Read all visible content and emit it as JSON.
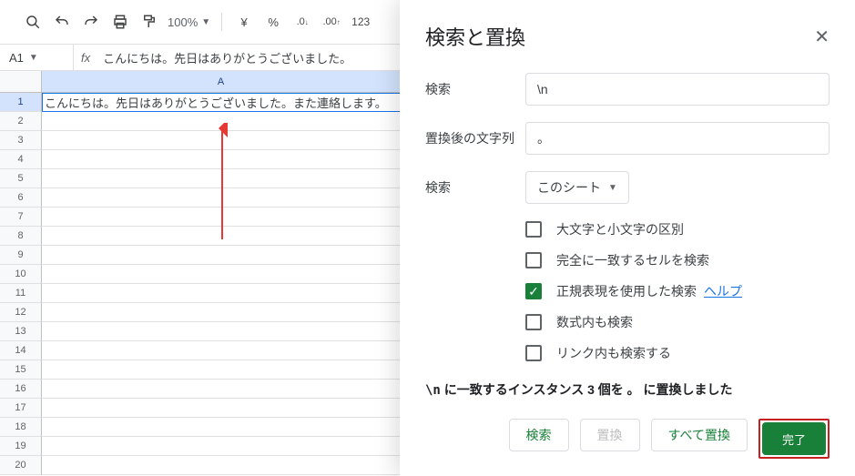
{
  "toolbar": {
    "zoom": "100%",
    "currency": "¥",
    "percent": "%",
    "dec_dec": ".0",
    "dec_inc": ".00",
    "format123": "123"
  },
  "formula": {
    "cellRef": "A1",
    "fx": "fx",
    "value": "こんにちは。先日はありがとうございました。"
  },
  "grid": {
    "columns": [
      "A"
    ],
    "rows": [
      1,
      2,
      3,
      4,
      5,
      6,
      7,
      8,
      9,
      10,
      11,
      12,
      13,
      14,
      15,
      16,
      17,
      18,
      19,
      20
    ],
    "cellA1": "こんにちは。先日はありがとうございました。また連絡します。"
  },
  "dialog": {
    "title": "検索と置換",
    "labels": {
      "find": "検索",
      "replace": "置換後の文字列",
      "scope": "検索"
    },
    "findValue": "\\n",
    "replaceValue": "。",
    "scopeValue": "このシート",
    "checkboxes": {
      "matchCase": "大文字と小文字の区別",
      "matchCell": "完全に一致するセルを検索",
      "regex": "正規表現を使用した検索",
      "regexHelp": "ヘルプ",
      "formulas": "数式内も検索",
      "links": "リンク内も検索する"
    },
    "status_prefix": "\\n",
    "status_mid": " に一致するインスタンス 3 個を ",
    "status_repl": "。",
    "status_suffix": " に置換しました",
    "buttons": {
      "find": "検索",
      "replace": "置換",
      "replaceAll": "すべて置換",
      "done": "完了"
    }
  }
}
